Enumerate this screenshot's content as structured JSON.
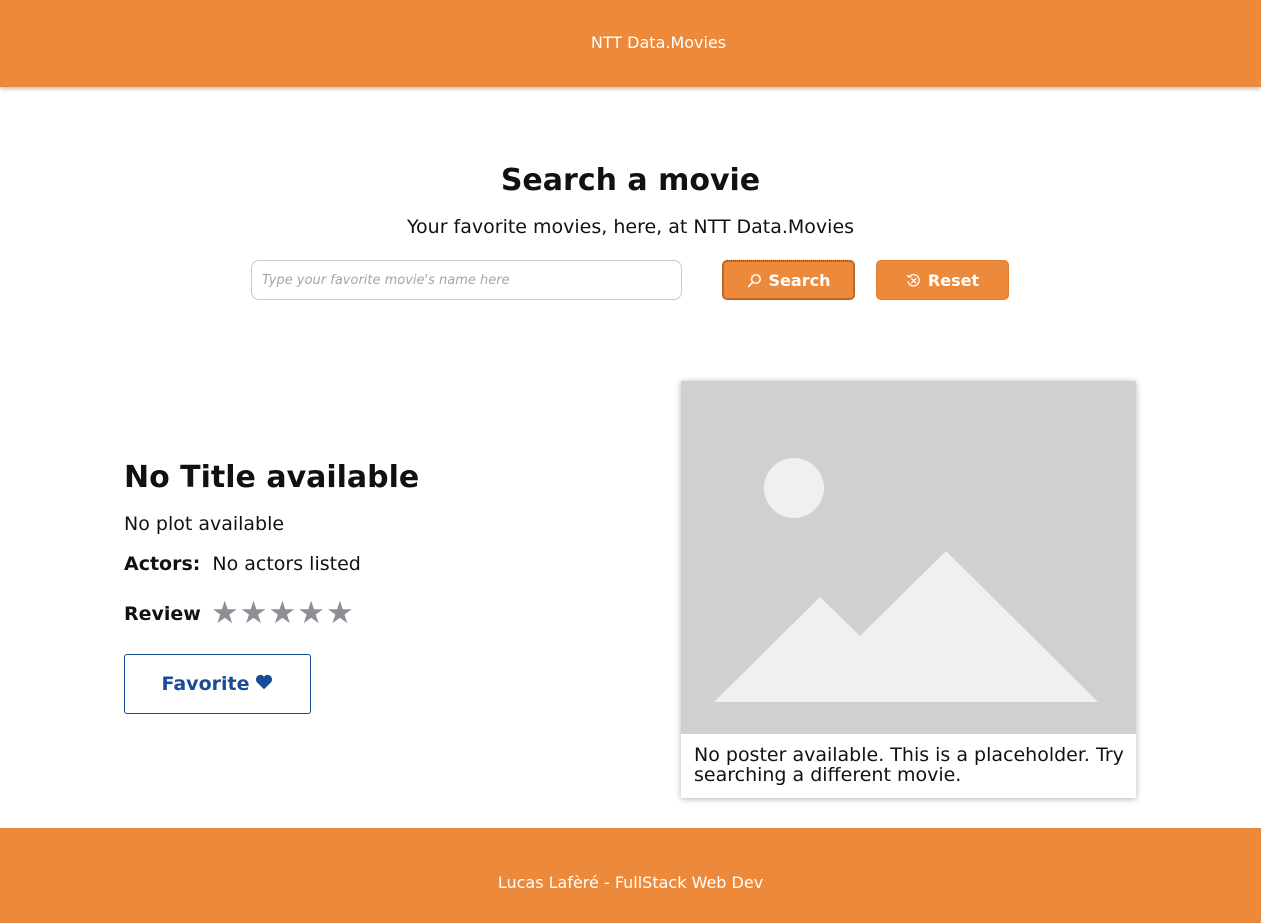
{
  "header": {
    "brand": "NTT Data.Movies"
  },
  "search": {
    "title": "Search a movie",
    "subtitle": "Your favorite movies, here, at NTT Data.Movies",
    "placeholder": "Type your favorite movie's name here",
    "value": "",
    "search_label": "Search",
    "search_icon": "search-icon",
    "reset_label": "Reset",
    "reset_icon": "reset-icon"
  },
  "movie": {
    "title": "No Title available",
    "plot": "No plot available",
    "actors_label": "Actors:",
    "actors": "No actors listed",
    "review_label": "Review",
    "rating": 0,
    "rating_max": 5,
    "favorite_label": "Favorite",
    "favorite_icon": "heart-icon",
    "poster_caption": "No poster available. This is a placeholder. Try searching a different movie."
  },
  "footer": {
    "text": "Lucas Lafèré - FullStack Web Dev"
  },
  "colors": {
    "brand_orange": "#ed893b",
    "favorite_blue": "#1a4b96",
    "star_gray": "#8c8f96",
    "placeholder_bg": "#d0d0d0",
    "placeholder_fg": "#eff0ef"
  }
}
